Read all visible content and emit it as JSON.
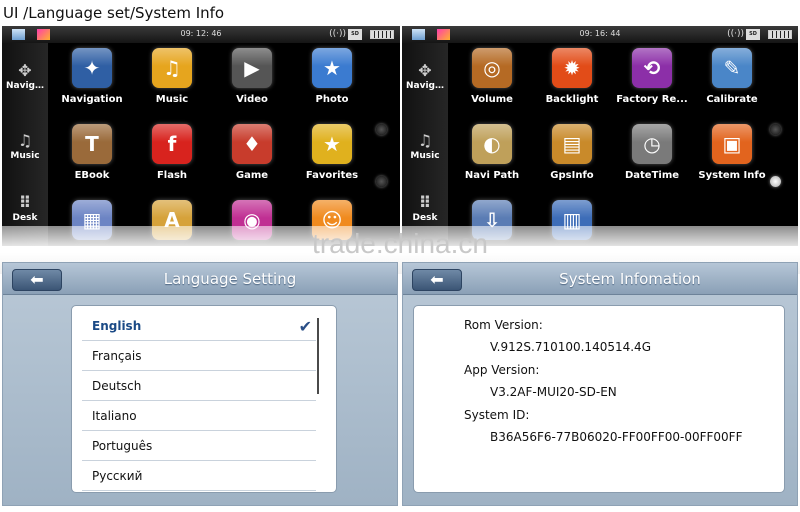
{
  "caption": "UI /Language set/System Info",
  "watermark": "trade.china.cn",
  "panel_left": {
    "time": "09: 12: 46",
    "sidebar": [
      {
        "label": "Navig…",
        "icon": "compass-icon"
      },
      {
        "label": "Music",
        "icon": "music-note-icon"
      },
      {
        "label": "Desk",
        "icon": "grid-icon"
      }
    ],
    "apps": [
      {
        "label": "Navigation",
        "icon": "compass-icon",
        "color": "#2f5fa4",
        "glyph": "✦"
      },
      {
        "label": "Music",
        "icon": "music-icon",
        "color": "#e6a51e",
        "glyph": "♫"
      },
      {
        "label": "Video",
        "icon": "film-icon",
        "color": "#555555",
        "glyph": "▶"
      },
      {
        "label": "Photo",
        "icon": "photo-icon",
        "color": "#3b7bd0",
        "glyph": "★"
      },
      {
        "label": "EBook",
        "icon": "book-icon",
        "color": "#9a6a3a",
        "glyph": "T"
      },
      {
        "label": "Flash",
        "icon": "flash-icon",
        "color": "#d8231e",
        "glyph": "f"
      },
      {
        "label": "Game",
        "icon": "game-icon",
        "color": "#c83c2c",
        "glyph": "♦"
      },
      {
        "label": "Favorites",
        "icon": "star-icon",
        "color": "#e0b11e",
        "glyph": "★"
      },
      {
        "label": "",
        "icon": "calculator-icon",
        "color": "#6c84c4",
        "glyph": "▦"
      },
      {
        "label": "",
        "icon": "text-icon",
        "color": "#d6a23a",
        "glyph": "A"
      },
      {
        "label": "",
        "icon": "wifi-icon",
        "color": "#c02f93",
        "glyph": "◉"
      },
      {
        "label": "",
        "icon": "smiley-icon",
        "color": "#f08a1e",
        "glyph": "☺"
      }
    ]
  },
  "panel_right": {
    "time": "09: 16: 44",
    "sidebar": [
      {
        "label": "Navig…",
        "icon": "compass-icon"
      },
      {
        "label": "Music",
        "icon": "music-note-icon"
      },
      {
        "label": "Desk",
        "icon": "grid-icon"
      }
    ],
    "apps": [
      {
        "label": "Volume",
        "icon": "speaker-icon",
        "color": "#b56a24",
        "glyph": "◎"
      },
      {
        "label": "Backlight",
        "icon": "sun-icon",
        "color": "#e24c18",
        "glyph": "✹"
      },
      {
        "label": "Factory Re...",
        "icon": "refresh-icon",
        "color": "#8c2fa8",
        "glyph": "⟲"
      },
      {
        "label": "Calibrate",
        "icon": "calibrate-icon",
        "color": "#4a86c8",
        "glyph": "✎"
      },
      {
        "label": "Navi Path",
        "icon": "path-icon",
        "color": "#bfa05a",
        "glyph": "◐"
      },
      {
        "label": "GpsInfo",
        "icon": "gps-info-icon",
        "color": "#c98a2a",
        "glyph": "▤"
      },
      {
        "label": "DateTime",
        "icon": "clock-icon",
        "color": "#7a7a7a",
        "glyph": "◷"
      },
      {
        "label": "System Info",
        "icon": "system-info-icon",
        "color": "#e2641e",
        "glyph": "▣"
      },
      {
        "label": "",
        "icon": "usb-icon",
        "color": "#5a7cb4",
        "glyph": "⇩"
      },
      {
        "label": "",
        "icon": "window-icon",
        "color": "#3d6db8",
        "glyph": "▥"
      }
    ]
  },
  "language_screen": {
    "back": "⬅",
    "title": "Language Setting",
    "languages": [
      "English",
      "Français",
      "Deutsch",
      "Italiano",
      "Português",
      "Русский"
    ],
    "selected_index": 0,
    "check": "✔"
  },
  "system_screen": {
    "back": "⬅",
    "title": "System Infomation",
    "rows": [
      {
        "label": "Rom Version:",
        "value": "V.912S.710100.140514.4G"
      },
      {
        "label": "App Version:",
        "value": "V3.2AF-MUI20-SD-EN"
      },
      {
        "label": "System ID:",
        "value": "B36A56F6-77B06020-FF00FF00-00FF00FF"
      }
    ]
  }
}
